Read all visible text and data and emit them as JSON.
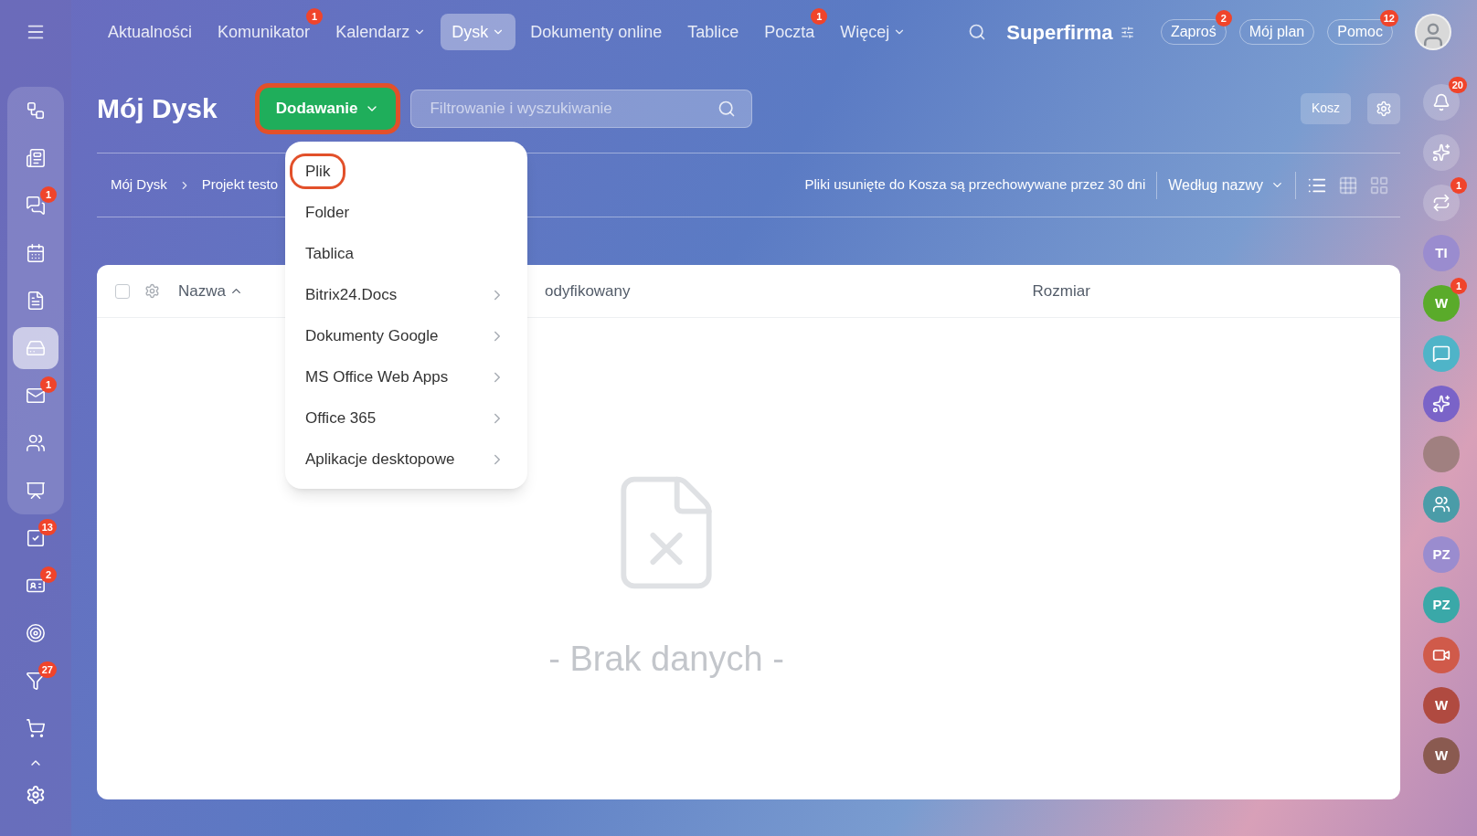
{
  "top_nav": {
    "items": [
      {
        "label": "Aktualności",
        "dropdown": false,
        "selected": false
      },
      {
        "label": "Komunikator",
        "badge": "1",
        "dropdown": false,
        "selected": false
      },
      {
        "label": "Kalendarz",
        "dropdown": true,
        "selected": false
      },
      {
        "label": "Dysk",
        "dropdown": true,
        "selected": true
      },
      {
        "label": "Dokumenty online",
        "dropdown": false,
        "selected": false
      },
      {
        "label": "Tablice",
        "dropdown": false,
        "selected": false
      },
      {
        "label": "Poczta",
        "badge": "1",
        "dropdown": false,
        "selected": false
      },
      {
        "label": "Więcej",
        "dropdown": true,
        "selected": false
      }
    ],
    "brand": "Superfirma",
    "buttons": [
      {
        "label": "Zaproś",
        "badge": "2"
      },
      {
        "label": "Mój plan"
      },
      {
        "label": "Pomoc",
        "badge": "12"
      }
    ]
  },
  "left_sidebar": {
    "items": [
      {
        "selected": false
      },
      {
        "selected": false
      },
      {
        "badge": "1",
        "selected": false
      },
      {
        "selected": false
      },
      {
        "selected": false
      },
      {
        "selected": true
      },
      {
        "badge": "1",
        "selected": false
      },
      {
        "selected": false
      },
      {
        "selected": false
      },
      {
        "badge": "13",
        "selected": false
      },
      {
        "badge": "2",
        "selected": false
      },
      {
        "selected": false
      },
      {
        "badge": "27",
        "selected": false
      },
      {
        "selected": false
      }
    ]
  },
  "right_sidebar": {
    "items": [
      {
        "kind": "icon",
        "badge": "20",
        "color": "#ffffff"
      },
      {
        "kind": "icon",
        "color": "#ffffff"
      },
      {
        "kind": "icon",
        "badge": "1",
        "color": "#ffffff"
      },
      {
        "kind": "avatar",
        "text": "TI",
        "color": "#9a8ccf"
      },
      {
        "kind": "avatar",
        "text": "W",
        "badge": "1",
        "color": "#5aab2a"
      },
      {
        "kind": "icon",
        "color": "#4fb4c8"
      },
      {
        "kind": "icon",
        "color": "#7a63c8"
      },
      {
        "kind": "photo",
        "color": "#a08080"
      },
      {
        "kind": "icon",
        "color": "#4a9ca8"
      },
      {
        "kind": "avatar",
        "text": "PZ",
        "color": "#9a8ccf"
      },
      {
        "kind": "avatar",
        "text": "PZ",
        "color": "#3aa8a8"
      },
      {
        "kind": "icon",
        "color": "#d05a4a"
      },
      {
        "kind": "avatar",
        "text": "W",
        "color": "#b04a40"
      },
      {
        "kind": "avatar",
        "text": "W",
        "color": "#8a5a50"
      }
    ]
  },
  "page": {
    "title": "Mój Dysk",
    "add_button": {
      "label": "Dodawanie",
      "highlighted": true
    },
    "search": {
      "placeholder": "Filtrowanie i wyszukiwanie"
    },
    "trash_button": "Kosz"
  },
  "toolbar": {
    "breadcrumbs": [
      "Mój Dysk",
      "Projekt testo"
    ],
    "notice": "Pliki usunięte do Kosza są przechowywane przez 30 dni",
    "sort": "Według nazwy",
    "views": [
      {
        "selected": true
      },
      {
        "selected": false
      },
      {
        "selected": false
      }
    ]
  },
  "table": {
    "select_all": {
      "checked": false
    },
    "columns": [
      {
        "label": "Nazwa",
        "sorted": true
      },
      {
        "label": "odyfikowany",
        "sorted": false
      },
      {
        "label": "Rozmiar",
        "sorted": false
      }
    ],
    "empty": "- Brak danych -"
  },
  "add_menu": {
    "items": [
      {
        "label": "Plik",
        "submenu": false,
        "highlighted": true
      },
      {
        "label": "Folder",
        "submenu": false,
        "highlighted": false
      },
      {
        "label": "Tablica",
        "submenu": false,
        "highlighted": false
      },
      {
        "label": "Bitrix24.Docs",
        "submenu": true,
        "highlighted": false
      },
      {
        "label": "Dokumenty Google",
        "submenu": true,
        "highlighted": false
      },
      {
        "label": "MS Office Web Apps",
        "submenu": true,
        "highlighted": false
      },
      {
        "label": "Office 365",
        "submenu": true,
        "highlighted": false
      },
      {
        "label": "Aplikacje desktopowe",
        "submenu": true,
        "highlighted": false
      }
    ]
  }
}
